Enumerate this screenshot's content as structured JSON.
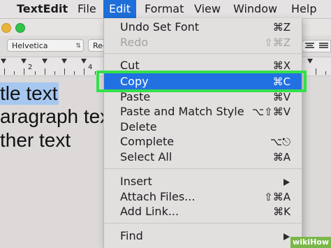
{
  "menubar": {
    "app_name": "TextEdit",
    "file": "File",
    "edit": "Edit",
    "format": "Format",
    "view": "View",
    "window": "Window",
    "help": "Help"
  },
  "toolbar": {
    "font_family": "Helvetica",
    "font_style": "Reg"
  },
  "ruler": {
    "numbers": [
      "2",
      "4"
    ]
  },
  "document": {
    "lines": [
      "tle text",
      "aragraph text",
      "ther text"
    ]
  },
  "edit_menu": {
    "items": [
      {
        "label": "Undo Set Font",
        "shortcut": "⌘Z",
        "disabled": false
      },
      {
        "label": "Redo",
        "shortcut": "⇧⌘Z",
        "disabled": true
      },
      {
        "label": "Cut",
        "shortcut": "⌘X",
        "disabled": false
      },
      {
        "label": "Copy",
        "shortcut": "⌘C",
        "highlighted": true
      },
      {
        "label": "Paste",
        "shortcut": "⌘V"
      },
      {
        "label": "Paste and Match Style",
        "shortcut": "⌥⇧⌘V"
      },
      {
        "label": "Delete",
        "shortcut": ""
      },
      {
        "label": "Complete",
        "shortcut": "⌥⎋"
      },
      {
        "label": "Select All",
        "shortcut": "⌘A"
      },
      {
        "label": "Insert",
        "shortcut": "",
        "submenu": true
      },
      {
        "label": "Attach Files...",
        "shortcut": "⇧⌘A"
      },
      {
        "label": "Add Link...",
        "shortcut": "⌘K"
      },
      {
        "label": "Find",
        "shortcut": "",
        "submenu": true
      }
    ]
  },
  "watermark": "wikiHow",
  "colors": {
    "highlight": "#2271e3",
    "annotation_frame": "#33e04a",
    "selection": "#a6c7f0"
  }
}
